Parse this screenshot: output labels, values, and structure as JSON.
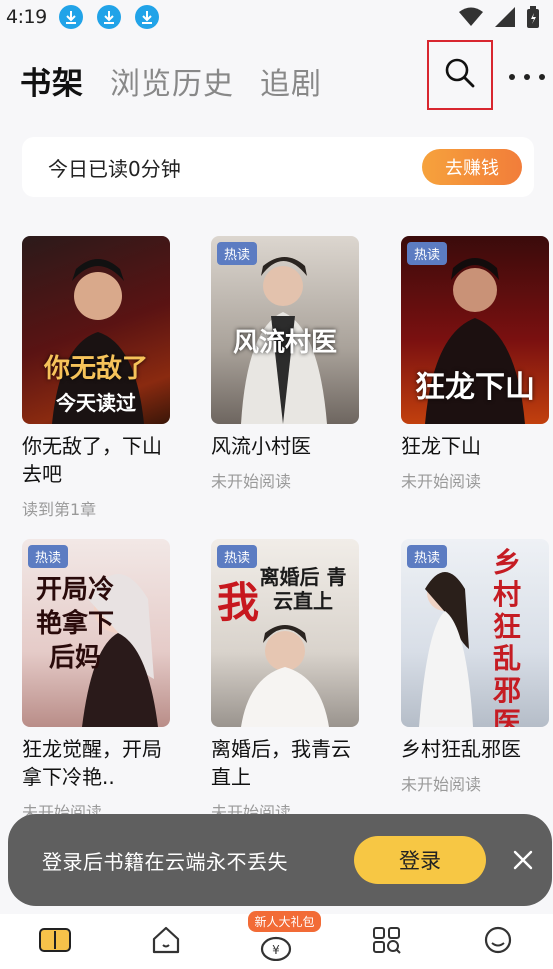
{
  "status_bar": {
    "time": "4:19"
  },
  "header": {
    "tabs": [
      "书架",
      "浏览历史",
      "追剧"
    ]
  },
  "reading": {
    "text": "今日已读0分钟",
    "button": "去赚钱"
  },
  "books": [
    {
      "title": "你无敌了，下山去吧",
      "status": "读到第1章",
      "badge": "",
      "cover_text": "今天读过"
    },
    {
      "title": "风流小村医",
      "status": "未开始阅读",
      "badge": "热读",
      "cover_text": "风流村医"
    },
    {
      "title": "狂龙下山",
      "status": "未开始阅读",
      "badge": "热读",
      "cover_text": "狂龙下山"
    },
    {
      "title": "狂龙觉醒，开局拿下冷艳..",
      "status": "未开始阅读",
      "badge": "热读",
      "cover_text": "开局冷艳拿下后妈"
    },
    {
      "title": "离婚后，我青云直上",
      "status": "未开始阅读",
      "badge": "热读",
      "cover_text": "离婚后 青云直上"
    },
    {
      "title": "乡村狂乱邪医",
      "status": "未开始阅读",
      "badge": "热读",
      "cover_text": "乡村狂乱邪医"
    }
  ],
  "toast": {
    "text": "登录后书籍在云端永不丢失",
    "button": "登录"
  },
  "bottom_nav": {
    "gift_tag": "新人大礼包"
  },
  "colors": {
    "accent_orange": "#f27d3a",
    "login_yellow": "#f7c744",
    "highlight_red": "#d8262f",
    "badge_blue": "#5c7cc2"
  }
}
